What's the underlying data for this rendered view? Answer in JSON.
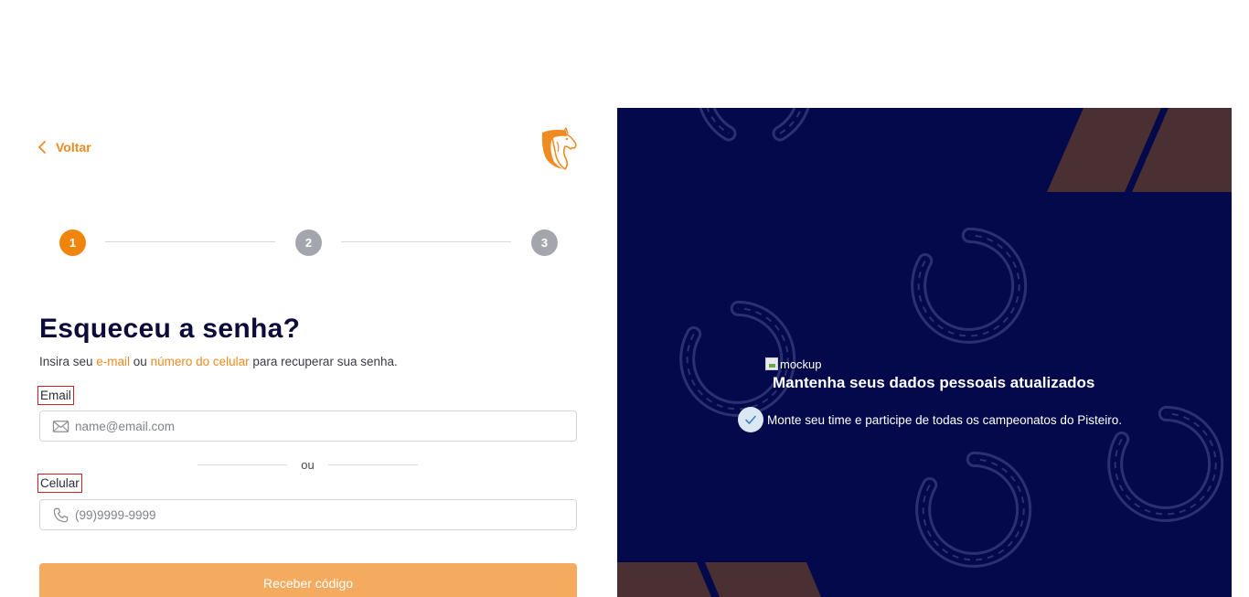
{
  "back": {
    "label": "Voltar"
  },
  "stepper": {
    "steps": [
      "1",
      "2",
      "3"
    ],
    "active_step": 1
  },
  "heading": {
    "title": "Esqueceu a senha?"
  },
  "subtitle": {
    "prefix": "Insira seu ",
    "email_highlight": "e-mail",
    "middle": " ou ",
    "phone_highlight": "número do celular",
    "suffix": " para recuperar sua senha."
  },
  "email": {
    "label": "Email",
    "placeholder": "name@email.com",
    "icon": "mail-icon"
  },
  "divider": {
    "text": "ou"
  },
  "phone": {
    "label": "Celular",
    "placeholder": "(99)9999-9999",
    "icon": "phone-icon"
  },
  "submit": {
    "label": "Receber código"
  },
  "promo": {
    "image_alt": "mockup",
    "title": "Mantenha seus dados pessoais atualizados",
    "feature_text": "Monte seu time e participe de todas os campeonatos do Pisteiro."
  },
  "colors": {
    "accent": "#ee8b22",
    "step_active": "#f0850d",
    "step_inactive": "#a3a7ad",
    "title": "#0d0b3a",
    "panel_bg": "#03094a",
    "stripe": "#4a3032",
    "button_bg": "#f4ab5f"
  }
}
